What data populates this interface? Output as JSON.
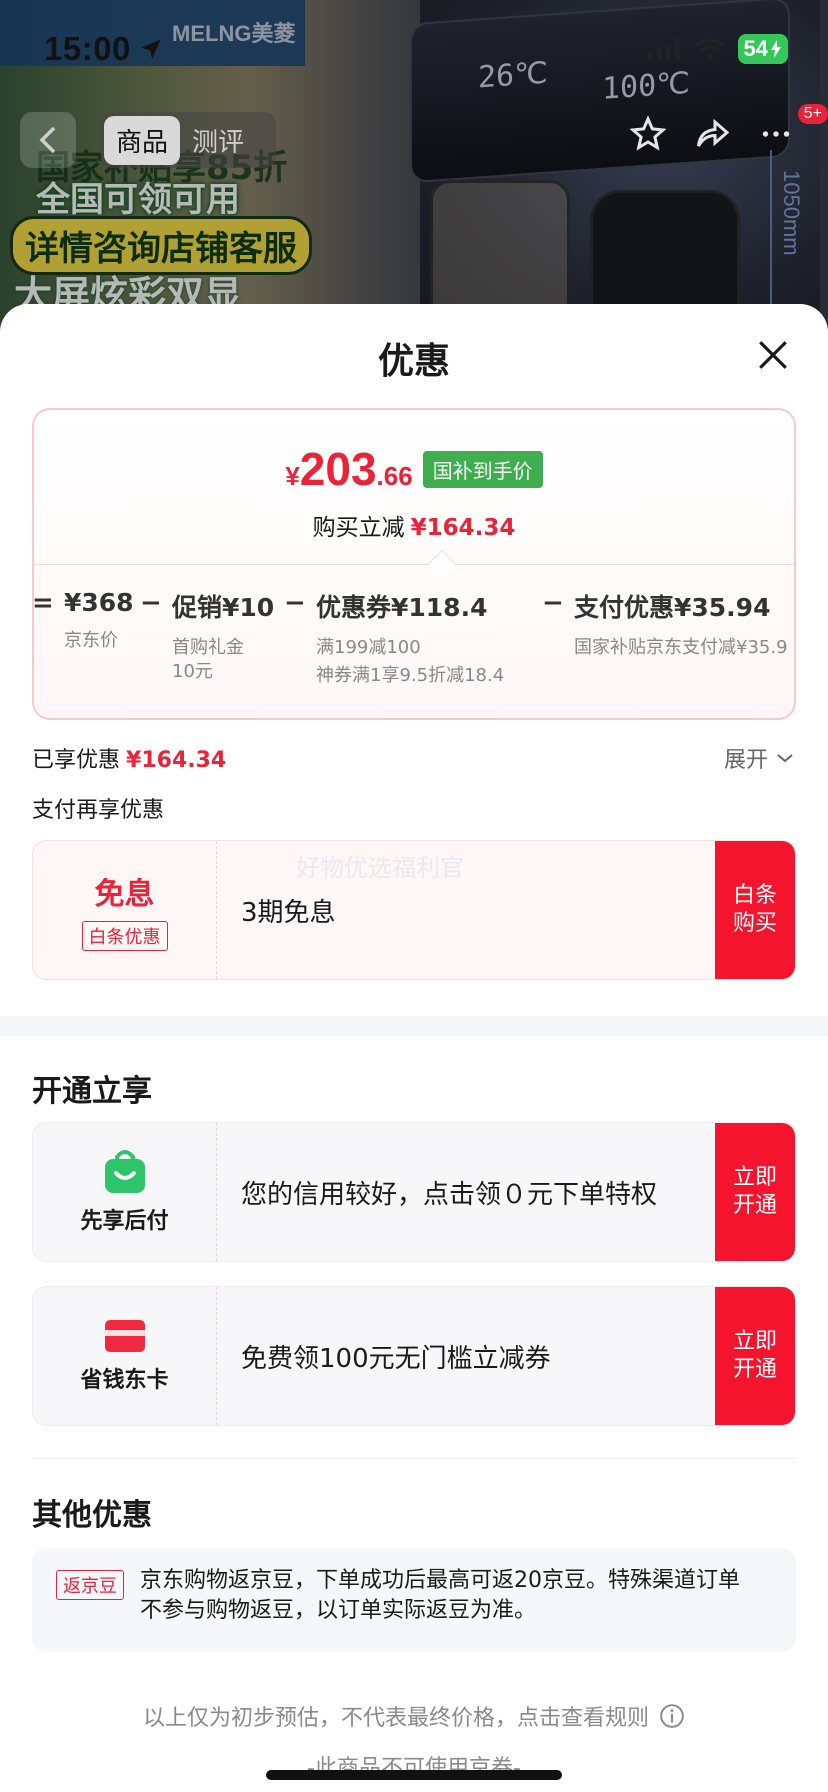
{
  "status_bar": {
    "time": "15:00",
    "battery": "54"
  },
  "background": {
    "brand_logo": "MELNG美菱",
    "promo_lines": [
      "国家补贴享85折",
      "全国可领可用",
      "详情咨询店铺客服",
      "大屏炫彩双显"
    ],
    "display_left": "26℃",
    "display_right": "100℃",
    "height_label": "1050mm"
  },
  "top_nav": {
    "tabs": [
      {
        "label": "商品",
        "active": true
      },
      {
        "label": "测评",
        "active": false
      }
    ],
    "cart_badge": "5+"
  },
  "sheet": {
    "title": "优惠",
    "price": {
      "currency": "¥",
      "integer": "203",
      "decimal": ".66",
      "tag": "国补到手价",
      "reduce_label": "购买立减",
      "reduce_amount": "¥164.34"
    },
    "breakdown": [
      {
        "op": "=",
        "value": "¥368",
        "subs": [
          "京东价"
        ]
      },
      {
        "op": "−",
        "value": "促销¥10",
        "subs": [
          "首购礼金",
          "10元"
        ]
      },
      {
        "op": "−",
        "value": "优惠券¥118.4",
        "subs": [
          "满199减100",
          "神券满1享9.5折减18.4"
        ]
      },
      {
        "op": "−",
        "value": "支付优惠¥35.94",
        "subs": [
          "国家补贴京东支付减¥35.9"
        ]
      }
    ],
    "enjoyed_label": "已享优惠",
    "enjoyed_amount": "¥164.34",
    "expand_label": "展开",
    "pay_more_label": "支付再享优惠",
    "interest_free": {
      "title": "免息",
      "badge": "白条优惠",
      "text": "3期免息",
      "button": "白条购买",
      "watermark": "好物优选福利官"
    },
    "open_section_title": "开通立享",
    "open_items": [
      {
        "label": "先享后付",
        "icon": "shopping-bag-icon",
        "text": "您的信用较好，点击领０元下单特权",
        "button": "立即开通"
      },
      {
        "label": "省钱东卡",
        "icon": "card-icon",
        "text": "免费领100元无门槛立减券",
        "button": "立即开通"
      }
    ],
    "other_section_title": "其他优惠",
    "other": {
      "badge": "返京豆",
      "text": "京东购物返京豆，下单成功后最高可返20京豆。特殊渠道订单不参与购物返豆，以订单实际返豆为准。"
    },
    "footer_note": "以上仅为初步预估，不代表最终价格，点击查看规则",
    "footer_note2": "-此商品不可使用京券-"
  },
  "colors": {
    "accent_red": "#e9233a",
    "button_red": "#f5142e",
    "tag_green": "#3fae4e",
    "icon_green": "#2ec46a"
  }
}
